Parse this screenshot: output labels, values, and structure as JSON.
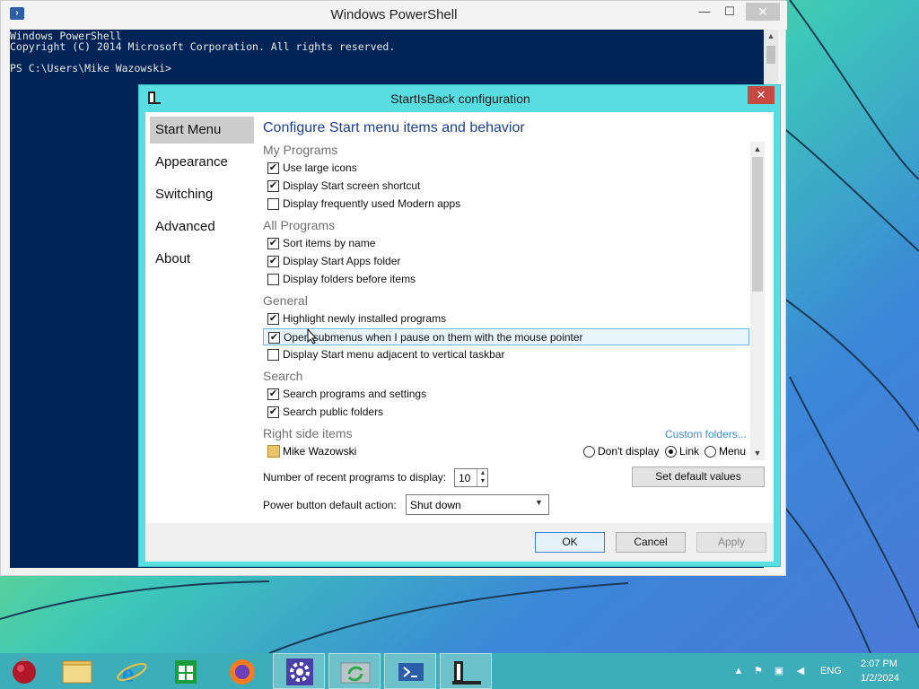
{
  "powershell": {
    "title": "Windows PowerShell",
    "lines": [
      "Windows PowerShell",
      "Copyright (C) 2014 Microsoft Corporation. All rights reserved.",
      "",
      "PS C:\\Users\\Mike Wazowski>"
    ],
    "min_glyph": "—",
    "max_glyph": "☐",
    "close_glyph": "✕"
  },
  "dialog": {
    "title": "StartIsBack configuration",
    "close_glyph": "✕",
    "nav": [
      {
        "label": "Start Menu",
        "selected": true
      },
      {
        "label": "Appearance",
        "selected": false
      },
      {
        "label": "Switching",
        "selected": false
      },
      {
        "label": "Advanced",
        "selected": false
      },
      {
        "label": "About",
        "selected": false
      }
    ],
    "heading": "Configure Start menu items and behavior",
    "sections": {
      "my_programs": "My Programs",
      "all_programs": "All Programs",
      "general": "General",
      "search": "Search",
      "right_side": "Right side items"
    },
    "options": [
      {
        "label": "Use large icons",
        "checked": true
      },
      {
        "label": "Display Start screen shortcut",
        "checked": true
      },
      {
        "label": "Display frequently used Modern apps",
        "checked": false
      },
      {
        "label": "Sort items by name",
        "checked": true
      },
      {
        "label": "Display Start Apps folder",
        "checked": true
      },
      {
        "label": "Display folders before items",
        "checked": false
      },
      {
        "label": "Highlight newly installed programs",
        "checked": true
      },
      {
        "label": "Open submenus when I pause on them with the mouse pointer",
        "checked": true,
        "highlighted": true
      },
      {
        "label": "Display Start menu adjacent to vertical taskbar",
        "checked": false
      },
      {
        "label": "Search programs and settings",
        "checked": true
      },
      {
        "label": "Search public folders",
        "checked": true
      }
    ],
    "custom_folders_link": "Custom folders...",
    "right_side_item": {
      "name": "Mike Wazowski",
      "radios": [
        {
          "label": "Don't display",
          "selected": false
        },
        {
          "label": "Link",
          "selected": true
        },
        {
          "label": "Menu",
          "selected": false
        }
      ]
    },
    "recent_programs_label": "Number of recent programs to display:",
    "recent_programs_value": "10",
    "set_default_label": "Set default values",
    "power_button_label": "Power button default action:",
    "power_button_value": "Shut down",
    "ok_label": "OK",
    "cancel_label": "Cancel",
    "apply_label": "Apply"
  },
  "taskbar": {
    "items": [
      {
        "icon": "start-orb-icon"
      },
      {
        "icon": "file-explorer-icon"
      },
      {
        "icon": "internet-explorer-icon"
      },
      {
        "icon": "store-icon"
      },
      {
        "icon": "firefox-icon"
      },
      {
        "icon": "settings-gear-icon"
      },
      {
        "icon": "sync-icon"
      },
      {
        "icon": "powershell-icon"
      },
      {
        "icon": "startisback-icon"
      }
    ],
    "language": "ENG",
    "time": "2:07 PM",
    "date": "1/2/2024"
  },
  "colors": {
    "console_bg": "#012456",
    "dialog_frame": "#58dde0",
    "heading": "#1d3f94",
    "link": "#3a8de0",
    "taskbar": "#3dadb9"
  }
}
